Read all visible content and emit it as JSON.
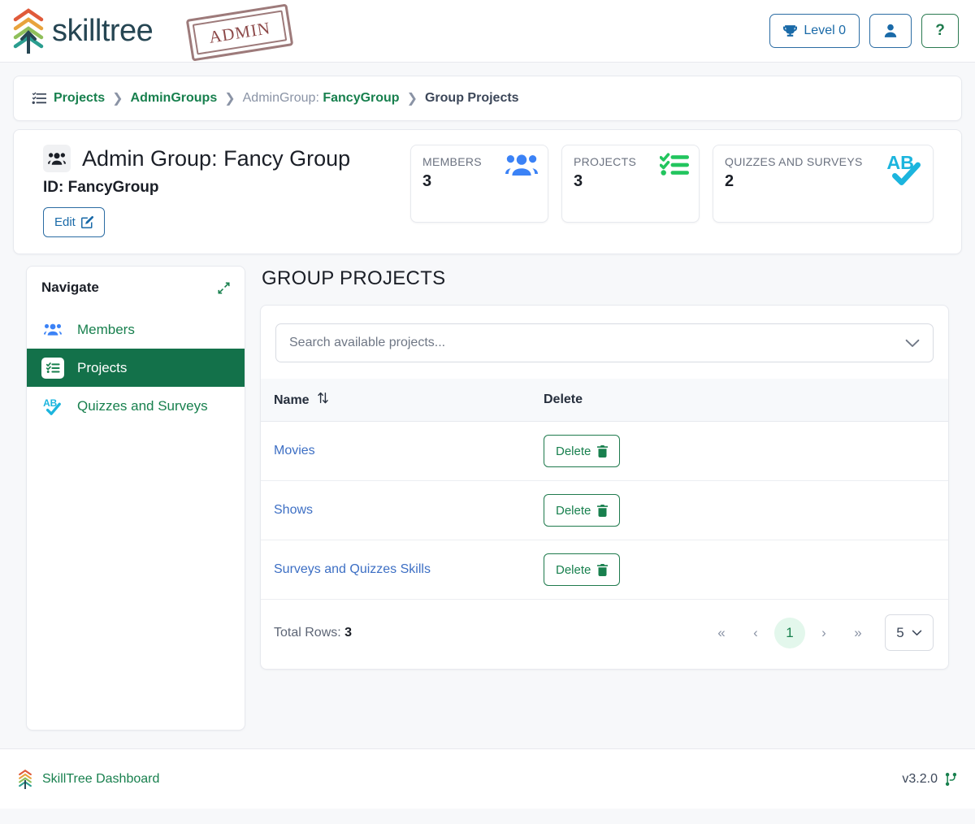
{
  "header": {
    "brand_name": "skilltree",
    "admin_stamp": "ADMIN",
    "logo_icon": "skilltree-chevron-logo",
    "level_button": {
      "label": "Level 0",
      "icon": "trophy-icon"
    },
    "user_button": {
      "icon": "user-icon"
    },
    "help_button": {
      "label": "?",
      "icon": "question-mark-icon"
    }
  },
  "breadcrumb": {
    "icon": "list-check-icon",
    "items": [
      {
        "label": "Projects",
        "style": "link"
      },
      {
        "label": "AdminGroups",
        "style": "link"
      },
      {
        "prefix": "AdminGroup:",
        "label": "FancyGroup",
        "style": "link"
      },
      {
        "label": "Group Projects",
        "style": "current"
      }
    ],
    "separator": "❯"
  },
  "title_card": {
    "icon": "users-group-icon",
    "title": "Admin Group: Fancy Group",
    "id_line": "ID: FancyGroup",
    "edit_button": {
      "label": "Edit",
      "icon": "pencil-square-icon"
    },
    "stats": [
      {
        "label": "MEMBERS",
        "value": "3",
        "icon": "users-icon",
        "color": "#3b82f6"
      },
      {
        "label": "PROJECTS",
        "value": "3",
        "icon": "tasks-checklist-icon",
        "color": "#22c55e"
      },
      {
        "label": "QUIZZES AND SURVEYS",
        "value": "2",
        "icon": "ab-check-icon",
        "color": "#1cb5de"
      }
    ]
  },
  "nav_panel": {
    "title": "Navigate",
    "collapse_icon": "compress-arrows-icon",
    "items": [
      {
        "label": "Members",
        "icon": "users-icon",
        "active": false
      },
      {
        "label": "Projects",
        "icon": "tasks-checklist-icon",
        "active": true
      },
      {
        "label": "Quizzes and Surveys",
        "icon": "ab-check-icon",
        "active": false
      }
    ]
  },
  "main": {
    "section_title": "GROUP PROJECTS",
    "search": {
      "placeholder": "Search available projects...",
      "value": "",
      "chevron_icon": "chevron-down-icon"
    },
    "table": {
      "columns": [
        {
          "label": "Name",
          "sortable": true,
          "sort_icon": "sort-arrows-icon"
        },
        {
          "label": "Delete",
          "sortable": false
        }
      ],
      "rows": [
        {
          "name": "Movies",
          "delete_label": "Delete",
          "delete_icon": "trash-icon"
        },
        {
          "name": "Shows",
          "delete_label": "Delete",
          "delete_icon": "trash-icon"
        },
        {
          "name": "Surveys and Quizzes Skills",
          "delete_label": "Delete",
          "delete_icon": "trash-icon"
        }
      ]
    },
    "pagination": {
      "total_rows_label": "Total Rows:",
      "total_rows_value": "3",
      "first_icon": "double-chevron-left-icon",
      "prev_icon": "chevron-left-icon",
      "pages": [
        "1"
      ],
      "active_page": "1",
      "next_icon": "chevron-right-icon",
      "last_icon": "double-chevron-right-icon",
      "per_page_value": "5",
      "per_page_chevron": "chevron-down-icon"
    }
  },
  "footer": {
    "logo_icon": "skilltree-chevron-logo",
    "link_label": "SkillTree Dashboard",
    "version": "v3.2.0",
    "version_icon": "code-branch-icon"
  },
  "colors": {
    "brand_green": "#18804e",
    "active_green": "#13714a",
    "link_blue": "#3d6fc4",
    "button_blue": "#1a6aa8",
    "teal": "#1cb5de",
    "stamp": "#9d7a7a"
  }
}
